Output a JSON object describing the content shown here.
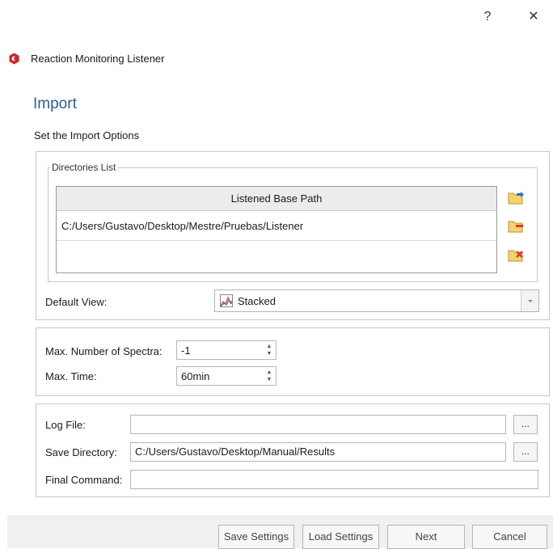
{
  "titlebar": {
    "help_glyph": "?",
    "close_glyph": "✕"
  },
  "app": {
    "title": "Reaction Monitoring Listener",
    "icon": "app-logo-icon",
    "icon_color": "#d0202a"
  },
  "page": {
    "title": "Import",
    "subtitle": "Set the Import Options",
    "title_color": "#2f5a9a"
  },
  "directories": {
    "legend": "Directories List",
    "column_header": "Listened Base Path",
    "rows": [
      "C:/Users/Gustavo/Desktop/Mestre/Pruebas/Listener",
      ""
    ],
    "buttons": [
      "add-folder-icon",
      "remove-folder-icon",
      "clear-folders-icon"
    ]
  },
  "default_view": {
    "label": "Default View:",
    "value": "Stacked",
    "icon": "stacked-chart-icon"
  },
  "limits": {
    "max_spectra_label": "Max. Number of Spectra:",
    "max_spectra_value": "-1",
    "max_time_label": "Max. Time:",
    "max_time_value": "60min"
  },
  "files": {
    "log_file_label": "Log File:",
    "log_file_value": "",
    "save_dir_label": "Save Directory:",
    "save_dir_value": "C:/Users/Gustavo/Desktop/Manual/Results",
    "final_cmd_label": "Final Command:",
    "final_cmd_value": "",
    "browse_label": "..."
  },
  "footer": {
    "save_settings": "Save Settings",
    "load_settings": "Load Settings",
    "next": "Next",
    "cancel": "Cancel"
  }
}
